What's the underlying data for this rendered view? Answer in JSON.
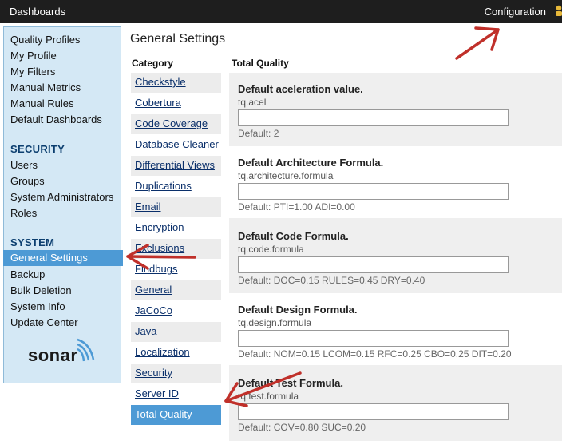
{
  "topbar": {
    "title": "Dashboards",
    "configuration": "Configuration"
  },
  "sidebar": {
    "items": [
      "Quality Profiles",
      "My Profile",
      "My Filters",
      "Manual Metrics",
      "Manual Rules",
      "Default Dashboards"
    ],
    "security_title": "SECURITY",
    "security_items": [
      "Users",
      "Groups",
      "System Administrators",
      "Roles"
    ],
    "system_title": "SYSTEM",
    "system_selected": "General Settings",
    "system_items": [
      "Backup",
      "Bulk Deletion",
      "System Info",
      "Update Center"
    ],
    "logo": "sonar"
  },
  "main": {
    "title": "General Settings",
    "category_header": "Category",
    "settings_header": "Total Quality",
    "categories": [
      "Checkstyle",
      "Cobertura",
      "Code Coverage",
      "Database Cleaner",
      "Differential Views",
      "Duplications",
      "Email",
      "Encryption",
      "Exclusions",
      "Findbugs",
      "General",
      "JaCoCo",
      "Java",
      "Localization",
      "Security",
      "Server ID",
      "Total Quality"
    ],
    "active_category": "Total Quality",
    "settings": [
      {
        "title": "Default aceleration value.",
        "key": "tq.acel",
        "value": "",
        "default": "Default: 2"
      },
      {
        "title": "Default Architecture Formula.",
        "key": "tq.architecture.formula",
        "value": "",
        "default": "Default: PTI=1.00 ADI=0.00"
      },
      {
        "title": "Default Code Formula.",
        "key": "tq.code.formula",
        "value": "",
        "default": "Default: DOC=0.15 RULES=0.45 DRY=0.40"
      },
      {
        "title": "Default Design Formula.",
        "key": "tq.design.formula",
        "value": "",
        "default": "Default: NOM=0.15 LCOM=0.15 RFC=0.25 CBO=0.25 DIT=0.20"
      },
      {
        "title": "Default Test Formula.",
        "key": "tq.test.formula",
        "value": "",
        "default": "Default: COV=0.80 SUC=0.20"
      }
    ]
  },
  "colors": {
    "topbar": "#1e1e1e",
    "sidebar": "#d4e8f5",
    "accent": "#4d9ad5",
    "arrow": "#c0302a"
  }
}
